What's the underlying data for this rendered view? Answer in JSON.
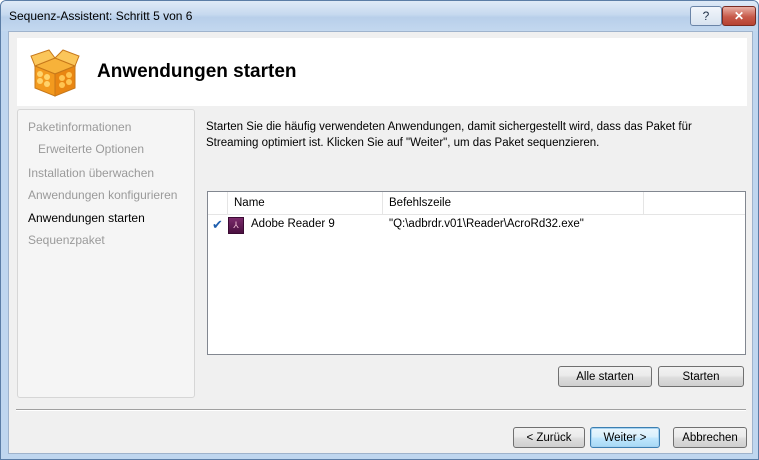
{
  "window": {
    "title": "Sequenz-Assistent: Schritt 5 von 6",
    "help_label": "?",
    "close_label": "✕"
  },
  "header": {
    "title": "Anwendungen starten",
    "icon": "package-icon"
  },
  "nav": {
    "items": [
      {
        "label": "Paketinformationen",
        "active": false
      },
      {
        "label": "Erweiterte Optionen",
        "active": false
      },
      {
        "label": "Installation überwachen",
        "active": false
      },
      {
        "label": "Anwendungen konfigurieren",
        "active": false
      },
      {
        "label": "Anwendungen starten",
        "active": true
      },
      {
        "label": "Sequenzpaket",
        "active": false
      }
    ]
  },
  "description": "Starten Sie die häufig verwendeten Anwendungen, damit sichergestellt wird, dass das Paket für Streaming optimiert ist. Klicken Sie auf \"Weiter\", um das Paket sequenzieren.",
  "list": {
    "columns": [
      "Name",
      "Befehlszeile"
    ],
    "rows": [
      {
        "checked": true,
        "icon": "adobe-reader-icon",
        "name": "Adobe Reader 9",
        "command": "\"Q:\\adbrdr.v01\\Reader\\AcroRd32.exe\""
      }
    ]
  },
  "buttons": {
    "start_all": "Alle starten",
    "start": "Starten",
    "back": "< Zurück",
    "next": "Weiter >",
    "cancel": "Abbrechen"
  }
}
